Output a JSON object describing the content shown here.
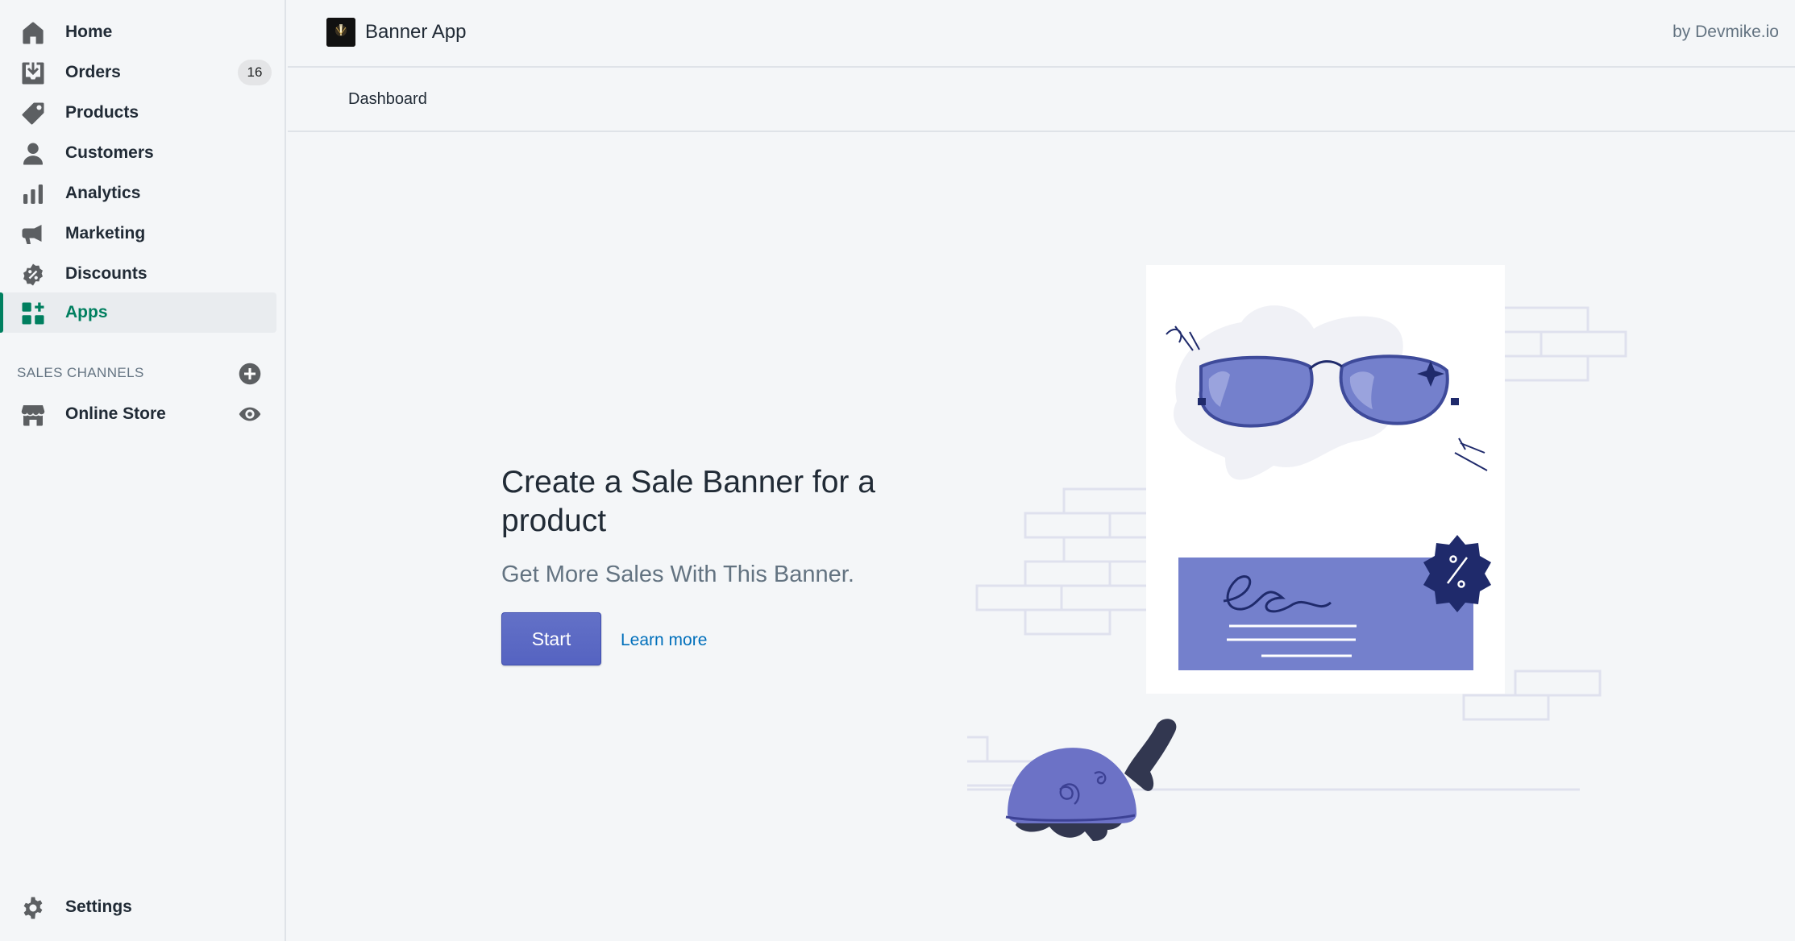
{
  "sidebar": {
    "items": [
      {
        "label": "Home",
        "icon": "home-icon"
      },
      {
        "label": "Orders",
        "icon": "orders-icon",
        "badge": "16"
      },
      {
        "label": "Products",
        "icon": "tag-icon"
      },
      {
        "label": "Customers",
        "icon": "person-icon"
      },
      {
        "label": "Analytics",
        "icon": "bar-chart-icon"
      },
      {
        "label": "Marketing",
        "icon": "megaphone-icon"
      },
      {
        "label": "Discounts",
        "icon": "discount-icon"
      },
      {
        "label": "Apps",
        "icon": "apps-icon",
        "active": true
      }
    ],
    "sales_channels_title": "SALES CHANNELS",
    "channels": [
      {
        "label": "Online Store",
        "icon": "store-icon"
      }
    ],
    "settings_label": "Settings"
  },
  "topbar": {
    "app_title": "Banner App",
    "byline": "by Devmike.io"
  },
  "tabs": {
    "dashboard": "Dashboard"
  },
  "main": {
    "headline": "Create a Sale Banner for a product",
    "subheadline": "Get More Sales With This Banner.",
    "start_label": "Start",
    "learn_more_label": "Learn more"
  },
  "colors": {
    "accent": "#008060",
    "primary_button": "#5c6ac4",
    "link": "#006fbb",
    "illustration_purple": "#7480cc",
    "illustration_navy": "#1f2a6b"
  }
}
